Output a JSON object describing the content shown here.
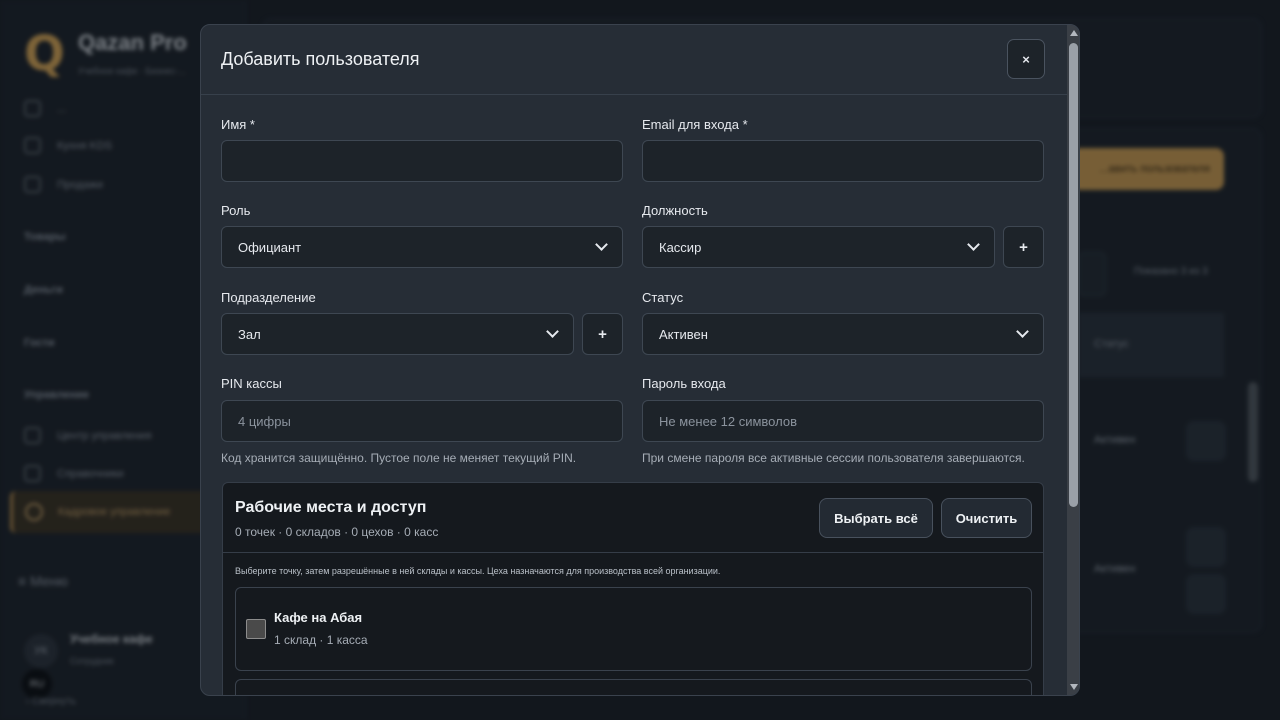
{
  "background": {
    "brand": "Qazan Pro",
    "brand_subtitle": "Учебное кафе · Бизнес-...",
    "nav": [
      "...",
      "Кухня KDS",
      "Продажи"
    ],
    "sections": [
      "Товары",
      "Деньги",
      "Гости",
      "Управление"
    ],
    "manage_items": [
      "Центр управления",
      "Справочники"
    ],
    "active_item": "Кадровое управление",
    "menu_label": "Меню",
    "user_initials": "УК",
    "user_name": "Учебное кафе",
    "user_role": "Сотрудник",
    "lang": "RU",
    "collapse_label": "Свернуть",
    "add_user_button": "...авить пользователя",
    "pager_text": "Показано 3 из 3",
    "status_header": "Статус",
    "row_status": [
      "Активен",
      "Активен"
    ]
  },
  "modal": {
    "title": "Добавить пользователя",
    "close_label": "×",
    "fields": {
      "name_label": "Имя *",
      "email_label": "Email для входа *",
      "role_label": "Роль",
      "role_value": "Официант",
      "position_label": "Должность",
      "position_value": "Кассир",
      "department_label": "Подразделение",
      "department_value": "Зал",
      "status_label": "Статус",
      "status_value": "Активен",
      "pin_label": "PIN кассы",
      "pin_placeholder": "4 цифры",
      "pin_hint": "Код хранится защищённо. Пустое поле не меняет текущий PIN.",
      "password_label": "Пароль входа",
      "password_placeholder": "Не менее 12 символов",
      "password_hint": "При смене пароля все активные сессии пользователя завершаются."
    },
    "plus_label": "+",
    "access": {
      "title": "Рабочие места и доступ",
      "counts": "0 точек · 0 складов · 0 цехов · 0 касс",
      "select_all": "Выбрать всё",
      "clear": "Очистить",
      "note": "Выберите точку, затем разрешённые в ней склады и кассы. Цеха назначаются для производства всей организации.",
      "locations": [
        {
          "name": "Кафе на Абая",
          "meta": "1 склад · 1 касса"
        }
      ]
    }
  }
}
